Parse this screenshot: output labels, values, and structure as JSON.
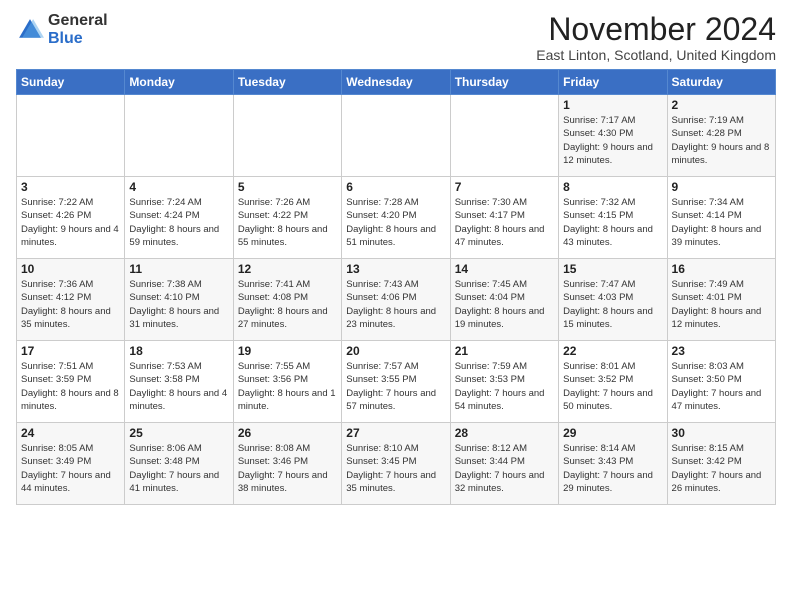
{
  "logo": {
    "general": "General",
    "blue": "Blue"
  },
  "title": "November 2024",
  "subtitle": "East Linton, Scotland, United Kingdom",
  "headers": [
    "Sunday",
    "Monday",
    "Tuesday",
    "Wednesday",
    "Thursday",
    "Friday",
    "Saturday"
  ],
  "weeks": [
    [
      {
        "day": "",
        "sunrise": "",
        "sunset": "",
        "daylight": ""
      },
      {
        "day": "",
        "sunrise": "",
        "sunset": "",
        "daylight": ""
      },
      {
        "day": "",
        "sunrise": "",
        "sunset": "",
        "daylight": ""
      },
      {
        "day": "",
        "sunrise": "",
        "sunset": "",
        "daylight": ""
      },
      {
        "day": "",
        "sunrise": "",
        "sunset": "",
        "daylight": ""
      },
      {
        "day": "1",
        "sunrise": "Sunrise: 7:17 AM",
        "sunset": "Sunset: 4:30 PM",
        "daylight": "Daylight: 9 hours and 12 minutes."
      },
      {
        "day": "2",
        "sunrise": "Sunrise: 7:19 AM",
        "sunset": "Sunset: 4:28 PM",
        "daylight": "Daylight: 9 hours and 8 minutes."
      }
    ],
    [
      {
        "day": "3",
        "sunrise": "Sunrise: 7:22 AM",
        "sunset": "Sunset: 4:26 PM",
        "daylight": "Daylight: 9 hours and 4 minutes."
      },
      {
        "day": "4",
        "sunrise": "Sunrise: 7:24 AM",
        "sunset": "Sunset: 4:24 PM",
        "daylight": "Daylight: 8 hours and 59 minutes."
      },
      {
        "day": "5",
        "sunrise": "Sunrise: 7:26 AM",
        "sunset": "Sunset: 4:22 PM",
        "daylight": "Daylight: 8 hours and 55 minutes."
      },
      {
        "day": "6",
        "sunrise": "Sunrise: 7:28 AM",
        "sunset": "Sunset: 4:20 PM",
        "daylight": "Daylight: 8 hours and 51 minutes."
      },
      {
        "day": "7",
        "sunrise": "Sunrise: 7:30 AM",
        "sunset": "Sunset: 4:17 PM",
        "daylight": "Daylight: 8 hours and 47 minutes."
      },
      {
        "day": "8",
        "sunrise": "Sunrise: 7:32 AM",
        "sunset": "Sunset: 4:15 PM",
        "daylight": "Daylight: 8 hours and 43 minutes."
      },
      {
        "day": "9",
        "sunrise": "Sunrise: 7:34 AM",
        "sunset": "Sunset: 4:14 PM",
        "daylight": "Daylight: 8 hours and 39 minutes."
      }
    ],
    [
      {
        "day": "10",
        "sunrise": "Sunrise: 7:36 AM",
        "sunset": "Sunset: 4:12 PM",
        "daylight": "Daylight: 8 hours and 35 minutes."
      },
      {
        "day": "11",
        "sunrise": "Sunrise: 7:38 AM",
        "sunset": "Sunset: 4:10 PM",
        "daylight": "Daylight: 8 hours and 31 minutes."
      },
      {
        "day": "12",
        "sunrise": "Sunrise: 7:41 AM",
        "sunset": "Sunset: 4:08 PM",
        "daylight": "Daylight: 8 hours and 27 minutes."
      },
      {
        "day": "13",
        "sunrise": "Sunrise: 7:43 AM",
        "sunset": "Sunset: 4:06 PM",
        "daylight": "Daylight: 8 hours and 23 minutes."
      },
      {
        "day": "14",
        "sunrise": "Sunrise: 7:45 AM",
        "sunset": "Sunset: 4:04 PM",
        "daylight": "Daylight: 8 hours and 19 minutes."
      },
      {
        "day": "15",
        "sunrise": "Sunrise: 7:47 AM",
        "sunset": "Sunset: 4:03 PM",
        "daylight": "Daylight: 8 hours and 15 minutes."
      },
      {
        "day": "16",
        "sunrise": "Sunrise: 7:49 AM",
        "sunset": "Sunset: 4:01 PM",
        "daylight": "Daylight: 8 hours and 12 minutes."
      }
    ],
    [
      {
        "day": "17",
        "sunrise": "Sunrise: 7:51 AM",
        "sunset": "Sunset: 3:59 PM",
        "daylight": "Daylight: 8 hours and 8 minutes."
      },
      {
        "day": "18",
        "sunrise": "Sunrise: 7:53 AM",
        "sunset": "Sunset: 3:58 PM",
        "daylight": "Daylight: 8 hours and 4 minutes."
      },
      {
        "day": "19",
        "sunrise": "Sunrise: 7:55 AM",
        "sunset": "Sunset: 3:56 PM",
        "daylight": "Daylight: 8 hours and 1 minute."
      },
      {
        "day": "20",
        "sunrise": "Sunrise: 7:57 AM",
        "sunset": "Sunset: 3:55 PM",
        "daylight": "Daylight: 7 hours and 57 minutes."
      },
      {
        "day": "21",
        "sunrise": "Sunrise: 7:59 AM",
        "sunset": "Sunset: 3:53 PM",
        "daylight": "Daylight: 7 hours and 54 minutes."
      },
      {
        "day": "22",
        "sunrise": "Sunrise: 8:01 AM",
        "sunset": "Sunset: 3:52 PM",
        "daylight": "Daylight: 7 hours and 50 minutes."
      },
      {
        "day": "23",
        "sunrise": "Sunrise: 8:03 AM",
        "sunset": "Sunset: 3:50 PM",
        "daylight": "Daylight: 7 hours and 47 minutes."
      }
    ],
    [
      {
        "day": "24",
        "sunrise": "Sunrise: 8:05 AM",
        "sunset": "Sunset: 3:49 PM",
        "daylight": "Daylight: 7 hours and 44 minutes."
      },
      {
        "day": "25",
        "sunrise": "Sunrise: 8:06 AM",
        "sunset": "Sunset: 3:48 PM",
        "daylight": "Daylight: 7 hours and 41 minutes."
      },
      {
        "day": "26",
        "sunrise": "Sunrise: 8:08 AM",
        "sunset": "Sunset: 3:46 PM",
        "daylight": "Daylight: 7 hours and 38 minutes."
      },
      {
        "day": "27",
        "sunrise": "Sunrise: 8:10 AM",
        "sunset": "Sunset: 3:45 PM",
        "daylight": "Daylight: 7 hours and 35 minutes."
      },
      {
        "day": "28",
        "sunrise": "Sunrise: 8:12 AM",
        "sunset": "Sunset: 3:44 PM",
        "daylight": "Daylight: 7 hours and 32 minutes."
      },
      {
        "day": "29",
        "sunrise": "Sunrise: 8:14 AM",
        "sunset": "Sunset: 3:43 PM",
        "daylight": "Daylight: 7 hours and 29 minutes."
      },
      {
        "day": "30",
        "sunrise": "Sunrise: 8:15 AM",
        "sunset": "Sunset: 3:42 PM",
        "daylight": "Daylight: 7 hours and 26 minutes."
      }
    ]
  ]
}
